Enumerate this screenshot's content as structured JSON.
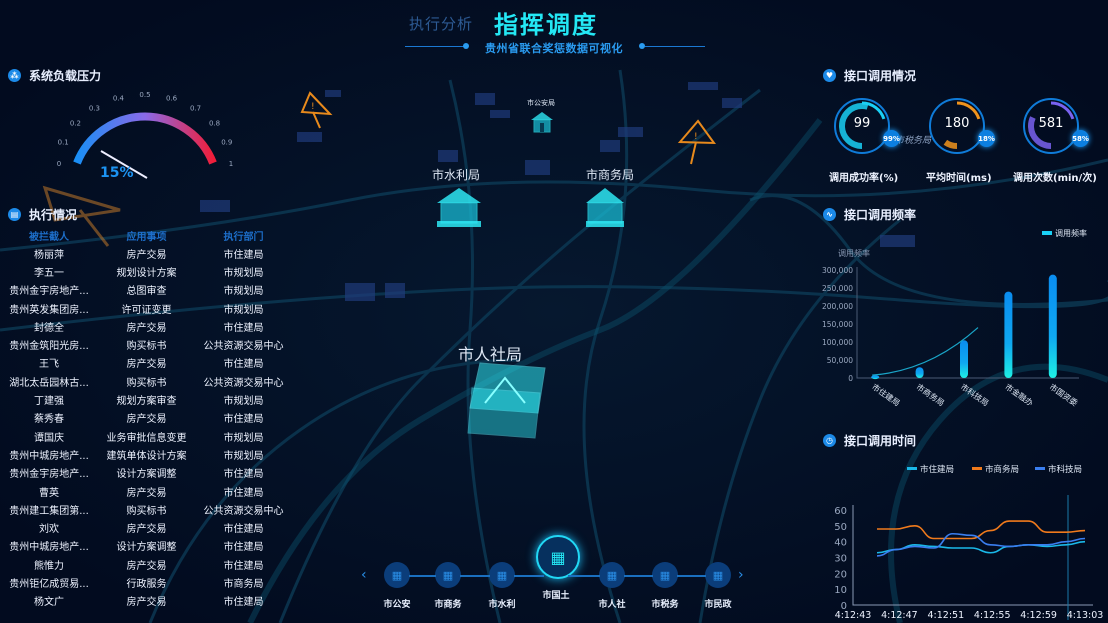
{
  "header": {
    "sub_title": "执行分析",
    "main_title": "指挥调度",
    "tagline": "贵州省联合奖惩数据可视化"
  },
  "colors": {
    "background": "#020b1f",
    "accent_cyan": "#24e8f5",
    "accent_blue": "#1c93f2",
    "warning_orange": "#e88a1c",
    "building_cyan": "#2ee6f2"
  },
  "load_panel": {
    "title": "系统负载压力",
    "icon": "network-icon",
    "gauge": {
      "value": 0.15,
      "value_label": "15%",
      "min": 0,
      "max": 1,
      "ticks": [
        "0",
        "0.1",
        "0.2",
        "0.3",
        "0.4",
        "0.5",
        "0.6",
        "0.7",
        "0.8",
        "0.9",
        "1"
      ]
    }
  },
  "exec_panel": {
    "title": "执行情况",
    "icon": "document-icon",
    "columns": [
      "被拦截人",
      "应用事项",
      "执行部门"
    ],
    "rows": [
      [
        "杨丽萍",
        "房产交易",
        "市住建局"
      ],
      [
        "李五一",
        "规划设计方案",
        "市规划局"
      ],
      [
        "贵州金宇房地产...",
        "总图审查",
        "市规划局"
      ],
      [
        "贵州英发集团房...",
        "许可证变更",
        "市规划局"
      ],
      [
        "封德全",
        "房产交易",
        "市住建局"
      ],
      [
        "贵州金筑阳光房...",
        "购买标书",
        "公共资源交易中心"
      ],
      [
        "王飞",
        "房产交易",
        "市住建局"
      ],
      [
        "湖北太岳园林古...",
        "购买标书",
        "公共资源交易中心"
      ],
      [
        "丁建强",
        "规划方案审查",
        "市规划局"
      ],
      [
        "蔡秀春",
        "房产交易",
        "市住建局"
      ],
      [
        "谭国庆",
        "业务审批信息变更",
        "市规划局"
      ],
      [
        "贵州中城房地产...",
        "建筑单体设计方案",
        "市规划局"
      ],
      [
        "贵州金宇房地产...",
        "设计方案调整",
        "市住建局"
      ],
      [
        "曹英",
        "房产交易",
        "市住建局"
      ],
      [
        "贵州建工集团第...",
        "购买标书",
        "公共资源交易中心"
      ],
      [
        "刘欢",
        "房产交易",
        "市住建局"
      ],
      [
        "贵州中城房地产...",
        "设计方案调整",
        "市住建局"
      ],
      [
        "熊惟力",
        "房产交易",
        "市住建局"
      ],
      [
        "贵州钜亿成贸易...",
        "行政服务",
        "市商务局"
      ],
      [
        "杨文广",
        "房产交易",
        "市住建局"
      ]
    ]
  },
  "interface_panel": {
    "title": "接口调用情况",
    "icon": "heart-shield-icon",
    "rings": [
      {
        "value": "99",
        "badge": "99%",
        "fraction": 0.99,
        "label": "调用成功率(%)",
        "color": "#1ad0f5"
      },
      {
        "value": "180",
        "badge": "18%",
        "fraction": 0.18,
        "label": "平均时间(ms)",
        "color": "#f0931c"
      },
      {
        "value": "581",
        "badge": "58%",
        "fraction": 0.58,
        "label": "调用次数(min/次)",
        "color": "#7a63f0"
      }
    ]
  },
  "freq_panel": {
    "title": "接口调用频率",
    "icon": "pulse-icon"
  },
  "time_panel": {
    "title": "接口调用时间",
    "icon": "clock-icon"
  },
  "map": {
    "labels": {
      "public_security_small": "市公安局",
      "water": "市水利局",
      "commerce": "市商务局",
      "hr": "市人社局",
      "tax_faint": "市税务局"
    }
  },
  "bottom_nav": {
    "prev_icon": "chevron-left-icon",
    "next_icon": "chevron-right-icon",
    "items": [
      {
        "label": "市公安",
        "active": false
      },
      {
        "label": "市商务",
        "active": false
      },
      {
        "label": "市水利",
        "active": false
      },
      {
        "label": "市国土",
        "active": true
      },
      {
        "label": "市人社",
        "active": false
      },
      {
        "label": "市税务",
        "active": false
      },
      {
        "label": "市民政",
        "active": false
      }
    ]
  },
  "chart_data": [
    {
      "type": "bar",
      "title": "接口调用频率",
      "ylabel": "调用频率",
      "legend": [
        "调用频率"
      ],
      "legend_position": "top-right",
      "categories": [
        "市住建局",
        "市商务局",
        "市科技局",
        "市金融办",
        "市国资委"
      ],
      "values": [
        8000,
        30000,
        105000,
        240000,
        287000
      ],
      "trend_line": [
        8000,
        28000,
        60000,
        100000,
        140000
      ],
      "yticks": [
        "0",
        "50,000",
        "100,000",
        "150,000",
        "200,000",
        "250,000",
        "300,000"
      ],
      "ylim": [
        0,
        300000
      ]
    },
    {
      "type": "line",
      "title": "接口调用时间",
      "legend_position": "top-right",
      "x": [
        "4:12:43",
        "4:12:47",
        "4:12:51",
        "4:12:55",
        "4:12:59",
        "4:13:03"
      ],
      "ylim": [
        0,
        60
      ],
      "yticks": [
        "0",
        "10",
        "20",
        "30",
        "40",
        "50",
        "60"
      ],
      "series": [
        {
          "name": "市住建局",
          "color": "#1ab8e8",
          "values": [
            33,
            35,
            38,
            37,
            36,
            36,
            33,
            37,
            38,
            37,
            38,
            40
          ]
        },
        {
          "name": "市商务局",
          "color": "#f07a1c",
          "values": [
            48,
            48,
            50,
            42,
            42,
            42,
            47,
            53,
            53,
            46,
            46,
            47
          ]
        },
        {
          "name": "市科技局",
          "color": "#3a7ef0",
          "values": [
            31,
            35,
            37,
            36,
            45,
            44,
            38,
            37,
            38,
            38,
            40,
            42
          ]
        }
      ]
    }
  ]
}
